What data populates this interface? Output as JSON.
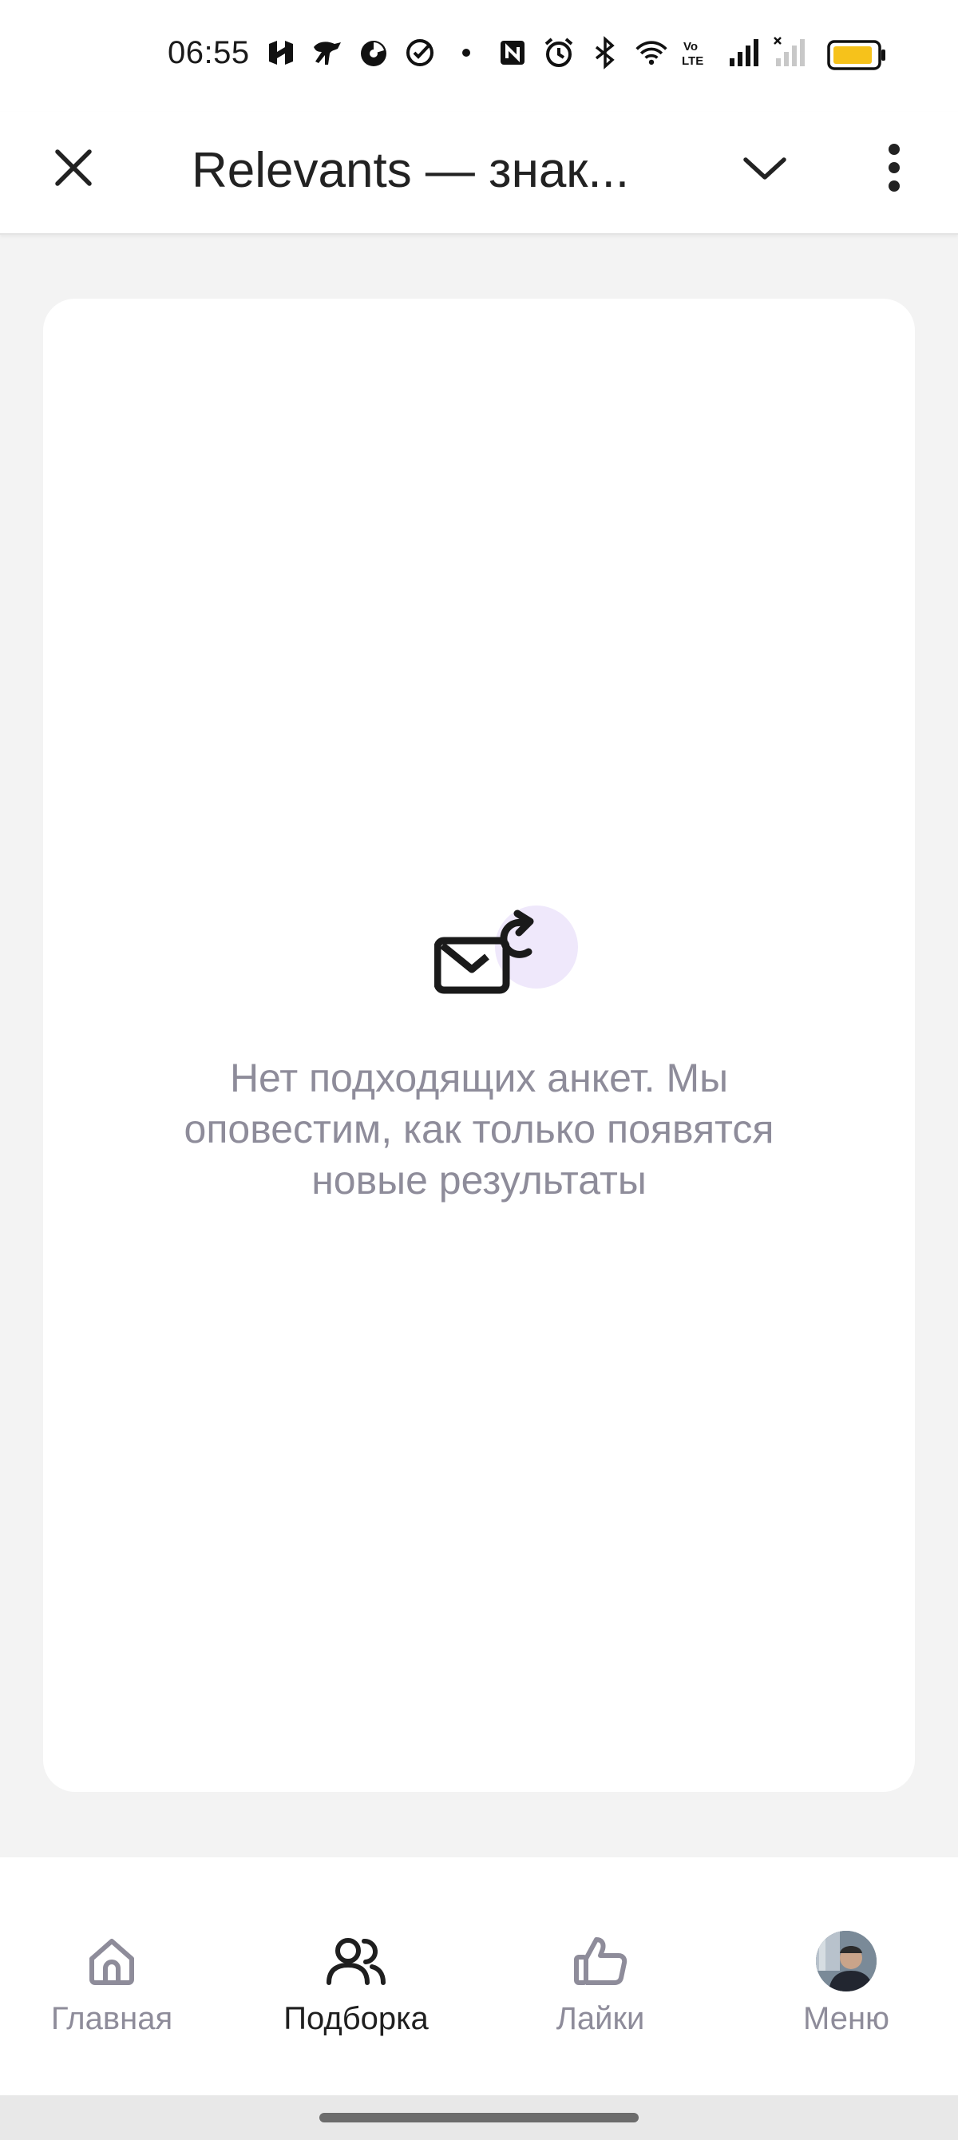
{
  "status_bar": {
    "time": "06:55",
    "icons": [
      "app-icon-1",
      "app-icon-2",
      "app-icon-3",
      "check-circle-icon",
      "dot-icon",
      "nfc-icon",
      "alarm-icon",
      "bluetooth-icon",
      "wifi-icon",
      "volte-icon",
      "signal-icon",
      "signal-x-icon"
    ],
    "battery_color": "#f6c21b"
  },
  "header": {
    "title": "Relevants — знак..."
  },
  "empty_state": {
    "icon": "mail-refresh-icon",
    "message": "Нет подходящих анкет. Мы оповестим, как только появятся новые результаты"
  },
  "bottom_nav": {
    "items": [
      {
        "label": "Главная",
        "icon": "home-icon"
      },
      {
        "label": "Подборка",
        "icon": "people-icon",
        "active": true
      },
      {
        "label": "Лайки",
        "icon": "thumbs-up-icon"
      },
      {
        "label": "Меню",
        "icon": "avatar"
      }
    ]
  },
  "colors": {
    "accent_light": "#efe8fb",
    "muted_text": "#8e8c9a",
    "background": "#f3f3f3"
  }
}
